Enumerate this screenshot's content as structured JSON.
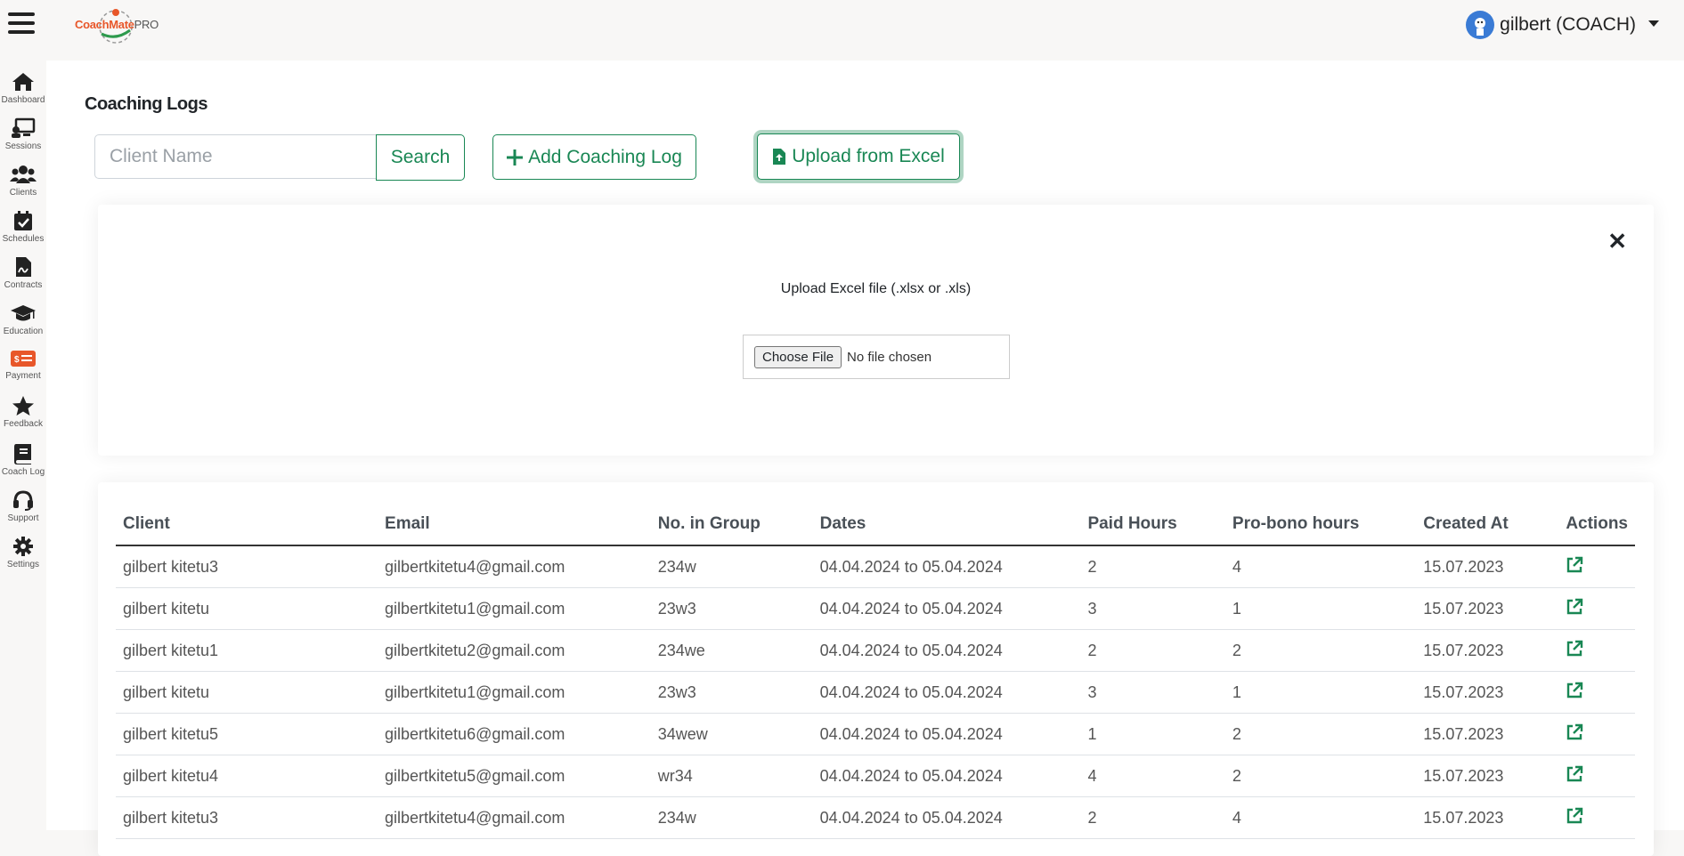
{
  "header": {
    "logo": {
      "brand_main": "CoachMate",
      "brand_suffix": "PRO"
    },
    "user": {
      "name": "gilbert (COACH)"
    }
  },
  "sidebar": {
    "items": [
      {
        "label": "Dashboard",
        "icon": "home-icon"
      },
      {
        "label": "Sessions",
        "icon": "presentation-icon"
      },
      {
        "label": "Clients",
        "icon": "users-icon"
      },
      {
        "label": "Schedules",
        "icon": "calendar-check-icon"
      },
      {
        "label": "Contracts",
        "icon": "contract-icon"
      },
      {
        "label": "Education",
        "icon": "graduation-cap-icon"
      },
      {
        "label": "Payment",
        "icon": "payment-icon"
      },
      {
        "label": "Feedback",
        "icon": "star-icon"
      },
      {
        "label": "Coach Log",
        "icon": "book-icon"
      },
      {
        "label": "Support",
        "icon": "headset-icon"
      },
      {
        "label": "Settings",
        "icon": "gear-icon"
      }
    ]
  },
  "main": {
    "title": "Coaching Logs",
    "search": {
      "placeholder": "Client Name",
      "button_label": "Search"
    },
    "add_button_label": "Add Coaching Log",
    "upload_button_label": "Upload from Excel",
    "upload_panel": {
      "close_symbol": "✕",
      "label": "Upload Excel file (.xlsx or .xls)",
      "choose_button_label": "Choose File",
      "file_status": "No file chosen"
    },
    "table": {
      "columns": [
        "Client",
        "Email",
        "No. in Group",
        "Dates",
        "Paid Hours",
        "Pro-bono hours",
        "Created At",
        "Actions"
      ],
      "rows": [
        {
          "client": "gilbert kitetu3",
          "email": "gilbertkitetu4@gmail.com",
          "group": "234w",
          "dates": "04.04.2024 to 05.04.2024",
          "paid": "2",
          "probono": "4",
          "created": "15.07.2023"
        },
        {
          "client": "gilbert kitetu",
          "email": "gilbertkitetu1@gmail.com",
          "group": "23w3",
          "dates": "04.04.2024 to 05.04.2024",
          "paid": "3",
          "probono": "1",
          "created": "15.07.2023"
        },
        {
          "client": "gilbert kitetu1",
          "email": "gilbertkitetu2@gmail.com",
          "group": "234we",
          "dates": "04.04.2024 to 05.04.2024",
          "paid": "2",
          "probono": "2",
          "created": "15.07.2023"
        },
        {
          "client": "gilbert kitetu",
          "email": "gilbertkitetu1@gmail.com",
          "group": "23w3",
          "dates": "04.04.2024 to 05.04.2024",
          "paid": "3",
          "probono": "1",
          "created": "15.07.2023"
        },
        {
          "client": "gilbert kitetu5",
          "email": "gilbertkitetu6@gmail.com",
          "group": "34wew",
          "dates": "04.04.2024 to 05.04.2024",
          "paid": "1",
          "probono": "2",
          "created": "15.07.2023"
        },
        {
          "client": "gilbert kitetu4",
          "email": "gilbertkitetu5@gmail.com",
          "group": "wr34",
          "dates": "04.04.2024 to 05.04.2024",
          "paid": "4",
          "probono": "2",
          "created": "15.07.2023"
        },
        {
          "client": "gilbert kitetu3",
          "email": "gilbertkitetu4@gmail.com",
          "group": "234w",
          "dates": "04.04.2024 to 05.04.2024",
          "paid": "2",
          "probono": "4",
          "created": "15.07.2023"
        }
      ]
    }
  },
  "colors": {
    "accent": "#198754",
    "payment_icon": "#e8572a",
    "logo_orange": "#e8572a"
  }
}
